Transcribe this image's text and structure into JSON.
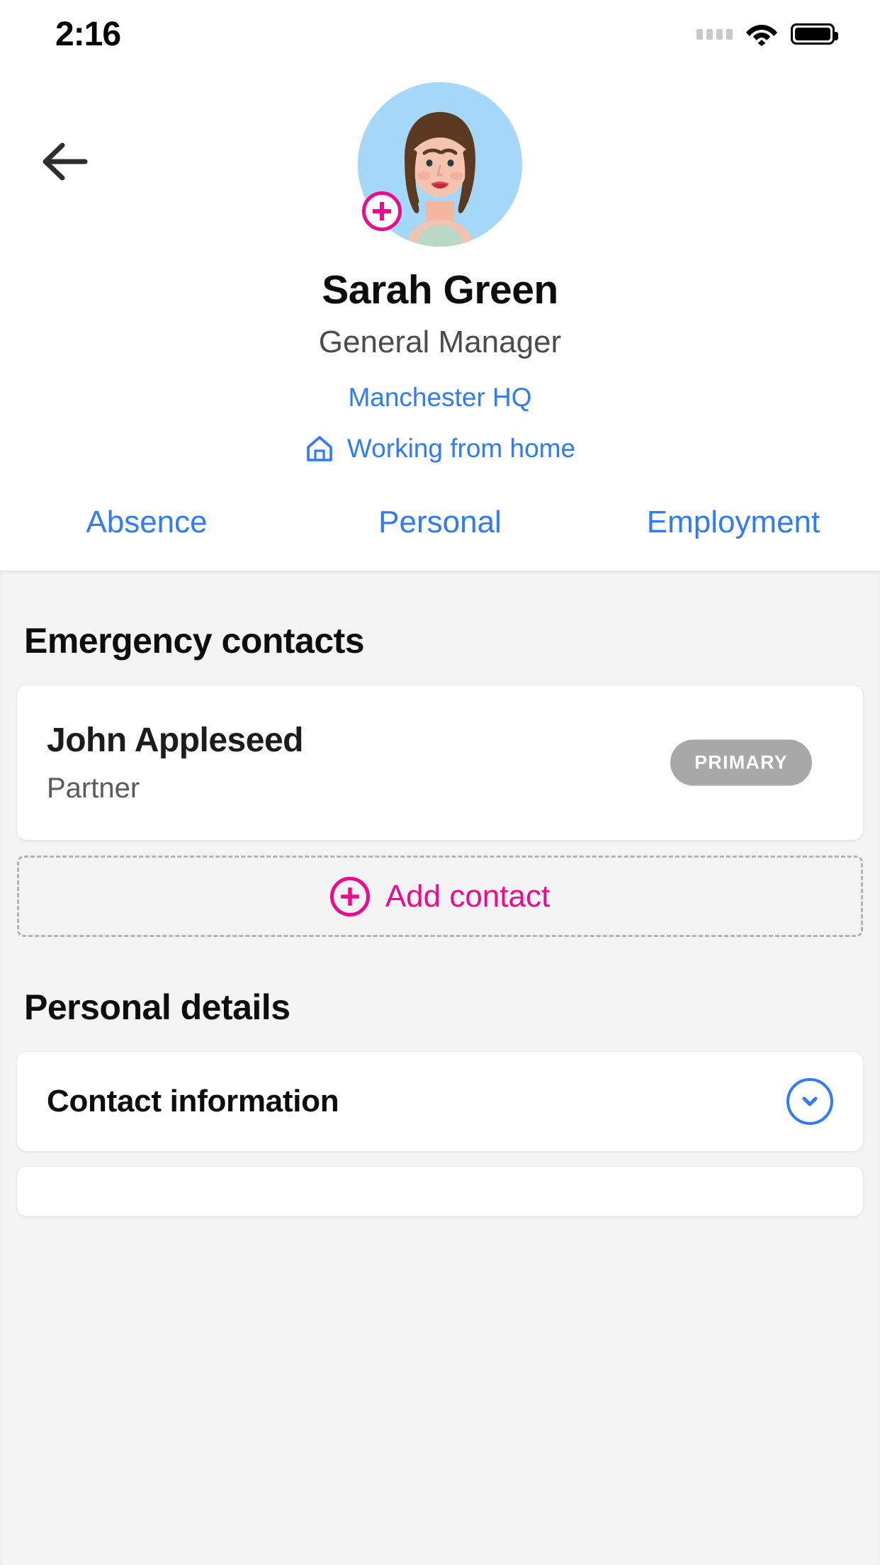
{
  "status_bar": {
    "time": "2:16",
    "signal_icon": "signal-dots-icon",
    "wifi_icon": "wifi-icon",
    "battery_icon": "battery-full-icon"
  },
  "header": {
    "back_icon": "back-arrow-icon",
    "avatar_alt": "avatar-illustration",
    "avatar_bg_color": "#a5d8f8",
    "add_photo_icon": "plus-circle-icon",
    "name": "Sarah Green",
    "job_title": "General Manager",
    "office": "Manchester HQ",
    "work_location_icon": "home-icon",
    "work_location": "Working from home",
    "link_color": "#2f7cf6",
    "accent_color": "#ec0b8c"
  },
  "tabs": [
    {
      "label": "Absence",
      "active": false
    },
    {
      "label": "Personal",
      "active": true
    },
    {
      "label": "Employment",
      "active": false
    }
  ],
  "emergency_contacts": {
    "heading": "Emergency contacts",
    "contacts": [
      {
        "name": "John Appleseed",
        "relationship": "Partner",
        "badge": "PRIMARY",
        "badge_color": "#a8a8a8"
      }
    ],
    "add_button": {
      "label": "Add contact",
      "icon": "plus-circle-icon"
    }
  },
  "personal_details": {
    "heading": "Personal details",
    "items": [
      {
        "label": "Contact information",
        "expand_icon": "chevron-down-icon"
      }
    ]
  }
}
